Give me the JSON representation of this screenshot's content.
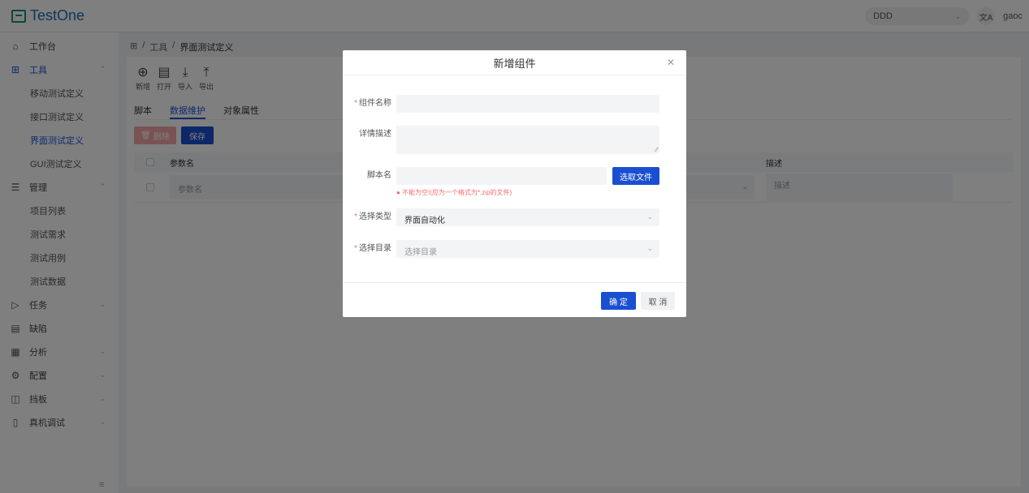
{
  "app": {
    "logo_text": "TestOne"
  },
  "header": {
    "project": "DDD",
    "translate_icon": "文A",
    "user": "gaoc"
  },
  "sidebar": {
    "items": [
      {
        "label": "工作台",
        "icon": "home-icon"
      },
      {
        "label": "工具",
        "icon": "grid-icon",
        "expanded": true,
        "children": [
          "移动测试定义",
          "接口测试定义",
          "界面测试定义",
          "GUI测试定义"
        ],
        "active_child": "界面测试定义"
      },
      {
        "label": "管理",
        "icon": "list-icon",
        "expanded": true,
        "children": [
          "项目列表",
          "测试需求",
          "测试用例",
          "测试数据"
        ]
      },
      {
        "label": "任务",
        "icon": "send-icon"
      },
      {
        "label": "缺陷",
        "icon": "doc-icon"
      },
      {
        "label": "分析",
        "icon": "calendar-icon"
      },
      {
        "label": "配置",
        "icon": "gear-icon"
      },
      {
        "label": "挡板",
        "icon": "panel-icon"
      },
      {
        "label": "真机调试",
        "icon": "device-icon"
      }
    ]
  },
  "breadcrumb": {
    "root_icon": "grid-icon",
    "sep": "/",
    "items": [
      "工具",
      "界面测试定义"
    ]
  },
  "toolbar": {
    "tools": [
      {
        "label": "新增",
        "icon": "plus-circle-icon"
      },
      {
        "label": "打开",
        "icon": "open-icon"
      },
      {
        "label": "导入",
        "icon": "download-icon"
      },
      {
        "label": "导出",
        "icon": "upload-icon"
      }
    ]
  },
  "tabs": [
    "脚本",
    "数据维护",
    "对象属性"
  ],
  "active_tab": "数据维护",
  "actions": {
    "delete": "删除",
    "save": "保存"
  },
  "table": {
    "headers": {
      "name": "参数名",
      "desc": "描述"
    },
    "row": {
      "name_placeholder": "参数名",
      "desc_placeholder": "描述"
    }
  },
  "modal": {
    "title": "新增组件",
    "fields": {
      "name_label": "组件名称",
      "desc_label": "详情描述",
      "script_label": "脚本名",
      "pick_button": "选取文件",
      "script_error": "不能为空!(应为一个格式为*.zip的文件)",
      "type_label": "选择类型",
      "type_value": "界面自动化",
      "dir_label": "选择目录",
      "dir_placeholder": "选择目录"
    },
    "ok": "确 定",
    "cancel": "取 消"
  },
  "colors": {
    "primary": "#1a4fd1",
    "danger": "#f56c6c"
  }
}
